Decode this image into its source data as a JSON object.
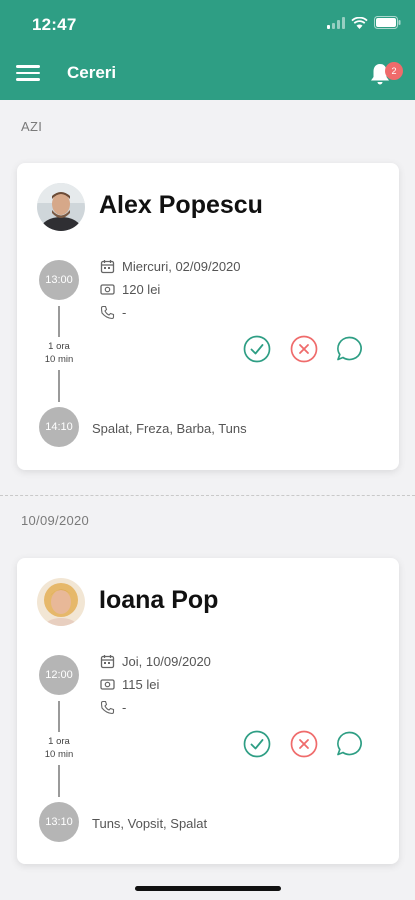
{
  "status_bar": {
    "time": "12:47",
    "icons": [
      "signal-icon",
      "wifi-icon",
      "battery-icon"
    ]
  },
  "app_bar": {
    "title": "Cereri",
    "notification_count": "2",
    "icons": [
      "menu-icon",
      "bell-icon"
    ]
  },
  "colors": {
    "primary": "#2e9e84",
    "accept": "#2e9e84",
    "reject": "#ef6b6b",
    "badge": "#ef6b6b",
    "time_circle": "#b5b5b5"
  },
  "sections": [
    {
      "label": "AZI",
      "request": {
        "client_name": "Alex Popescu",
        "start_time": "13:00",
        "end_time": "14:10",
        "duration_line1": "1 ora",
        "duration_line2": "10 min",
        "date": "Miercuri, 02/09/2020",
        "price": "120 lei",
        "phone": "-",
        "services": "Spalat, Freza, Barba, Tuns"
      }
    },
    {
      "label": "10/09/2020",
      "request": {
        "client_name": "Ioana Pop",
        "start_time": "12:00",
        "end_time": "13:10",
        "duration_line1": "1 ora",
        "duration_line2": "10 min",
        "date": "Joi, 10/09/2020",
        "price": "115 lei",
        "phone": "-",
        "services": "Tuns, Vopsit, Spalat"
      }
    }
  ]
}
